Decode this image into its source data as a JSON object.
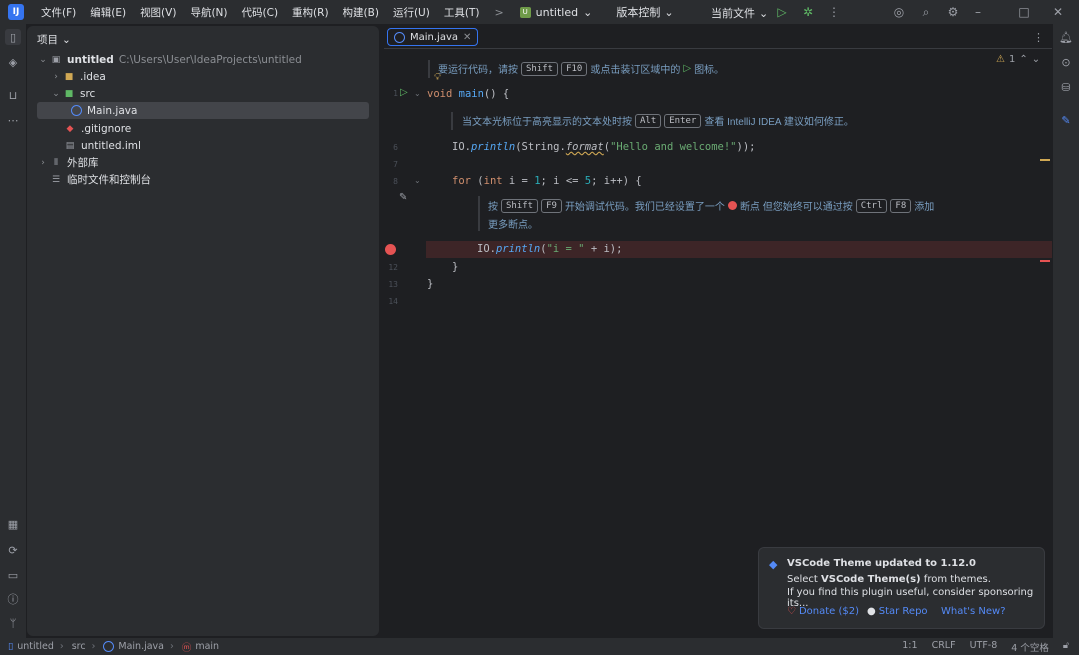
{
  "app": {
    "logo": "IJ"
  },
  "menu": [
    "文件(F)",
    "编辑(E)",
    "视图(V)",
    "导航(N)",
    "代码(C)",
    "重构(R)",
    "构建(B)",
    "运行(U)",
    "工具(T)"
  ],
  "toolbar": {
    "more": ">",
    "project_name": "untitled",
    "project_chip_letter": "U",
    "vcs_label": "版本控制",
    "run_config": "当前文件"
  },
  "project_panel": {
    "title": "项目",
    "tree": [
      {
        "name": "untitled",
        "path": "C:\\Users\\User\\IdeaProjects\\untitled"
      },
      {
        "name": ".idea"
      },
      {
        "name": "src"
      },
      {
        "name": "Main.java"
      },
      {
        "name": ".gitignore"
      },
      {
        "name": "untitled.iml"
      },
      {
        "name": "外部库"
      },
      {
        "name": "临时文件和控制台"
      }
    ]
  },
  "editor": {
    "tab": "Main.java",
    "inspection_count": "1",
    "line_numbers": [
      "1",
      "6",
      "7",
      "8",
      "12",
      "13",
      "14"
    ],
    "hints": {
      "h1_pre": "要运行代码，请按",
      "h1_key1": "Shift",
      "h1_key2": "F10",
      "h1_post": "或点击装订区域中的",
      "h1_end": "图标。",
      "h2_pre": "当文本光标位于高亮显示的文本处时按",
      "h2_key1": "Alt",
      "h2_key2": "Enter",
      "h2_post": "查看 IntelliJ IDEA 建议如何修正。",
      "h3_pre": "按",
      "h3_key1": "Shift",
      "h3_key2": "F9",
      "h3_mid": "开始调试代码。我们已经设置了一个",
      "h3_mid2": "断点 但您始终可以通过按",
      "h3_key3": "Ctrl",
      "h3_key4": "F8",
      "h3_post": "添加",
      "h3_line2": "更多断点。"
    },
    "code": {
      "l1_kw": "void",
      "l1_fn": "main",
      "l1_rest": "() {",
      "l6_a": "IO.",
      "l6_fn": "println",
      "l6_b": "(String.",
      "l6_fmt": "format",
      "l6_c": "(",
      "l6_str": "\"Hello and welcome!\"",
      "l6_d": "));",
      "l8_kw1": "for",
      "l8_a": " (",
      "l8_kw2": "int",
      "l8_b": " i = ",
      "l8_n1": "1",
      "l8_c": "; i <= ",
      "l8_n2": "5",
      "l8_d": "; i++) {",
      "l10_a": "IO.",
      "l10_fn": "println",
      "l10_b": "(",
      "l10_str": "\"i = \"",
      "l10_c": " + i);",
      "close_inner": "}",
      "close_outer": "}"
    }
  },
  "notification": {
    "title": "VSCode Theme updated to 1.12.0",
    "body_pre": "Select ",
    "body_bold": "VSCode Theme(s)",
    "body_post": " from themes.",
    "body2": "If you find this plugin useful, consider sponsoring its...",
    "link_donate": "Donate ($2)",
    "link_star": "Star Repo",
    "link_whatsnew": "What's New?"
  },
  "statusbar": {
    "crumbs": [
      "untitled",
      "src",
      "Main.java",
      "main"
    ],
    "position": "1:1",
    "line_sep": "CRLF",
    "encoding": "UTF-8",
    "indent": "4 个空格"
  },
  "colors": {
    "accent": "#3574f0",
    "breakpoint": "#e55353",
    "keyword": "#cf8e6d",
    "string": "#6aab73",
    "function": "#56a8f5"
  }
}
